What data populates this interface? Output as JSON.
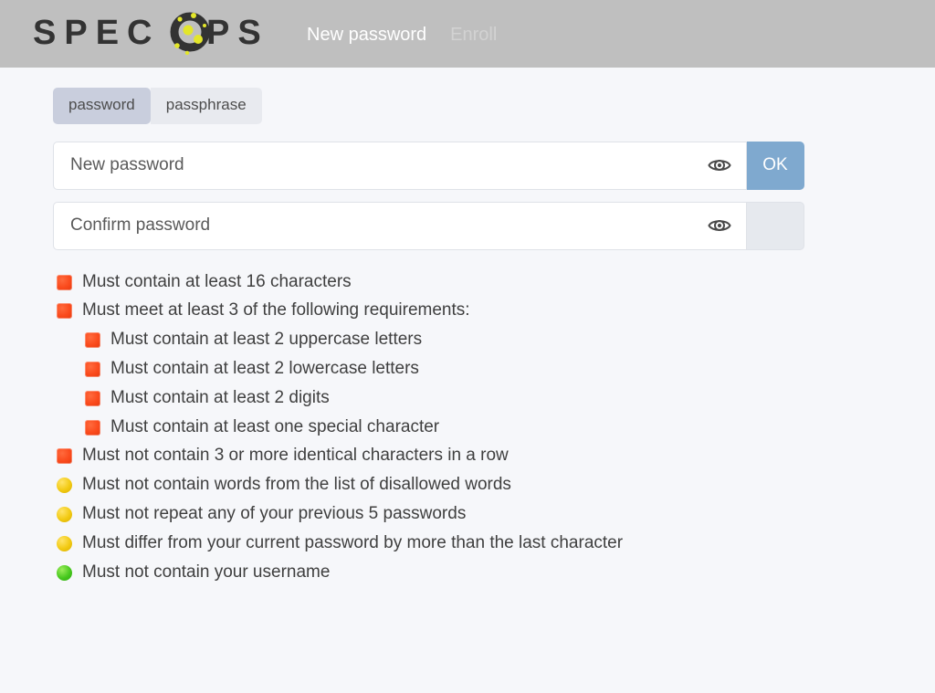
{
  "header": {
    "logo_text": "SPECOPS",
    "logo_accent_color": "#e3e62a",
    "nav": [
      {
        "label": "New password",
        "active": true
      },
      {
        "label": "Enroll",
        "active": false
      }
    ]
  },
  "tabs": [
    {
      "label": "password",
      "active": true
    },
    {
      "label": "passphrase",
      "active": false
    }
  ],
  "fields": [
    {
      "placeholder": "New password",
      "value": "",
      "eye_icon": "eye-icon",
      "button_label": "OK",
      "button_state": "primary"
    },
    {
      "placeholder": "Confirm password",
      "value": "",
      "eye_icon": "eye-icon",
      "button_label": "",
      "button_state": "disabled"
    }
  ],
  "requirements": [
    {
      "label": "Must contain at least 16 characters",
      "status": "fail",
      "indent": 0
    },
    {
      "label": "Must meet at least 3 of the following requirements:",
      "status": "fail",
      "indent": 0
    },
    {
      "label": "Must contain at least 2 uppercase letters",
      "status": "fail",
      "indent": 1
    },
    {
      "label": "Must contain at least 2 lowercase letters",
      "status": "fail",
      "indent": 1
    },
    {
      "label": "Must contain at least 2 digits",
      "status": "fail",
      "indent": 1
    },
    {
      "label": "Must contain at least one special character",
      "status": "fail",
      "indent": 1
    },
    {
      "label": "Must not contain 3 or more identical characters in a row",
      "status": "fail",
      "indent": 0
    },
    {
      "label": "Must not contain words from the list of disallowed words",
      "status": "warn",
      "indent": 0
    },
    {
      "label": "Must not repeat any of your previous 5 passwords",
      "status": "warn",
      "indent": 0
    },
    {
      "label": "Must differ from your current password by more than the last character",
      "status": "warn",
      "indent": 0
    },
    {
      "label": "Must not contain your username",
      "status": "pass",
      "indent": 0
    }
  ],
  "colors": {
    "header_bg": "#bfbfbf",
    "page_bg": "#f6f7fa",
    "primary_button": "#7fa9cf",
    "tab_active": "#c9cedd",
    "tab_inactive": "#e8eaef",
    "status_fail": "#fa4a1c",
    "status_warn": "#f2ca12",
    "status_pass": "#47c81e"
  }
}
